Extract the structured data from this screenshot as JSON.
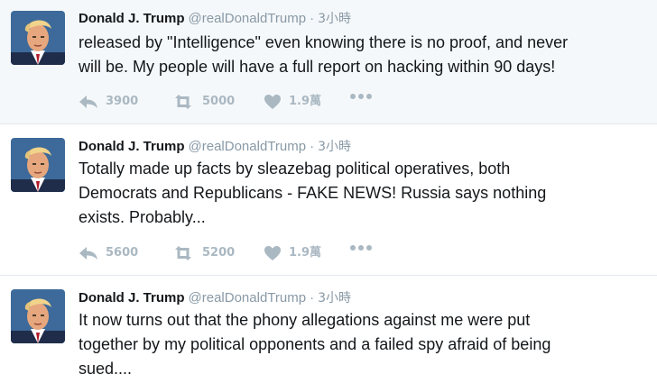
{
  "author": {
    "name": "Donald J. Trump",
    "handle": "@realDonaldTrump"
  },
  "tweets": [
    {
      "time": "3小時",
      "lines": [
        "released by \"Intelligence\" even knowing there is no proof, and never",
        "will be. My people will have a full report on hacking within 90 days!"
      ],
      "replies": "3900",
      "retweets": "5000",
      "likes": "1.9萬"
    },
    {
      "time": "3小時",
      "lines": [
        "Totally made up facts by sleazebag political operatives, both",
        "Democrats and Republicans - FAKE NEWS! Russia says nothing",
        "exists. Probably..."
      ],
      "replies": "5600",
      "retweets": "5200",
      "likes": "1.9萬"
    },
    {
      "time": "3小時",
      "lines": [
        "It now turns out that the phony allegations against me were put",
        "together by my political opponents and a failed spy afraid of being",
        "sued...."
      ]
    }
  ],
  "icons": {
    "reply": "reply-icon",
    "retweet": "retweet-icon",
    "like": "heart-icon",
    "more": "more-icon"
  },
  "colors": {
    "action_gray": "#aab8c2",
    "secondary_text": "#8899a6",
    "highlight_bg": "#f5f8fa",
    "divider": "#e1e8ed"
  }
}
